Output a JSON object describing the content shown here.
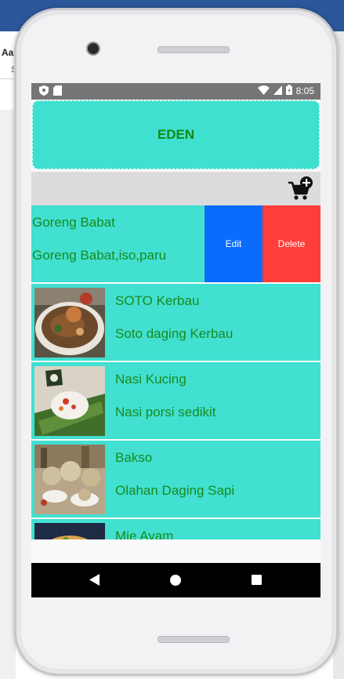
{
  "desktop": {
    "left_text_1": "Aal",
    "left_text_2": "S"
  },
  "status_bar": {
    "time": "8:05"
  },
  "header": {
    "title": "EDEN"
  },
  "toolbar": {
    "cart_icon": "add-to-cart-icon"
  },
  "swiped_item": {
    "name": "Goreng Babat",
    "description": "Goreng Babat,iso,paru",
    "edit_label": "Edit",
    "delete_label": "Delete"
  },
  "items": [
    {
      "name": "SOTO Kerbau",
      "description": "Soto daging Kerbau"
    },
    {
      "name": "Nasi Kucing",
      "description": "Nasi porsi sedikit"
    },
    {
      "name": "Bakso",
      "description": "Olahan Daging Sapi"
    },
    {
      "name": "Mie Ayam",
      "description": ""
    }
  ],
  "colors": {
    "header_bg": "#3fe0d0",
    "item_bg": "#41e0d0",
    "text_green": "#198a1e",
    "edit_bg": "#0a6cff",
    "delete_bg": "#ff3d3a"
  }
}
